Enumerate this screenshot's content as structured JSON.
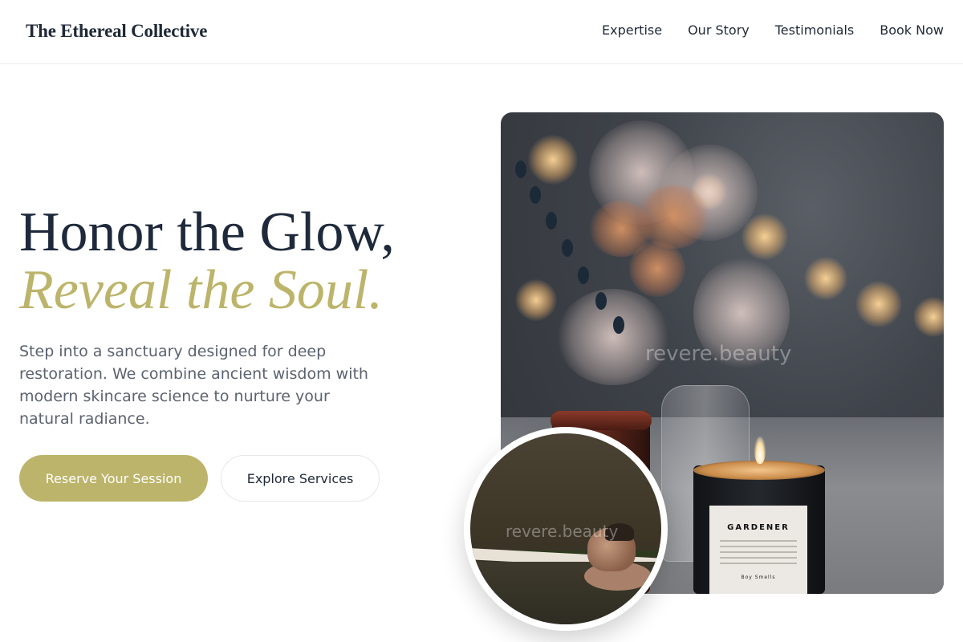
{
  "brand": {
    "name": "The Ethereal Collective"
  },
  "nav": {
    "items": [
      {
        "label": "Expertise"
      },
      {
        "label": "Our Story"
      },
      {
        "label": "Testimonials"
      },
      {
        "label": "Book Now"
      }
    ]
  },
  "hero": {
    "headline_line1": "Honor the Glow,",
    "headline_line2": "Reveal the Soul.",
    "lead": "Step into a sanctuary designed for deep restoration. We combine ancient wisdom with modern skincare science to nurture your natural radiance.",
    "primary_button": "Reserve Your Session",
    "secondary_button": "Explore Services"
  },
  "images": {
    "main_watermark": "revere.beauty",
    "candle_label": "GARDENER",
    "candle_maker": "Boy Smells",
    "inset_watermark": "revere.beauty"
  },
  "colors": {
    "accent": "#bcb46a",
    "headline": "#1e293b",
    "body_text": "#5b6270"
  }
}
